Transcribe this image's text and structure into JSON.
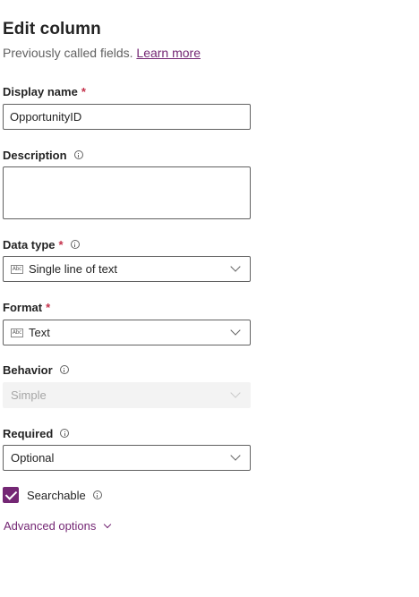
{
  "header": {
    "title": "Edit column",
    "subtitle": "Previously called fields.",
    "learn_more": "Learn more"
  },
  "fields": {
    "display_name": {
      "label": "Display name",
      "required_mark": "*",
      "value": "OpportunityID"
    },
    "description": {
      "label": "Description",
      "value": ""
    },
    "data_type": {
      "label": "Data type",
      "required_mark": "*",
      "value": "Single line of text",
      "icon": "abc-text-icon"
    },
    "format": {
      "label": "Format",
      "required_mark": "*",
      "value": "Text",
      "icon": "abc-text-icon"
    },
    "behavior": {
      "label": "Behavior",
      "value": "Simple",
      "disabled": true
    },
    "required": {
      "label": "Required",
      "value": "Optional"
    }
  },
  "searchable": {
    "label": "Searchable",
    "checked": true
  },
  "advanced": {
    "label": "Advanced options"
  },
  "colors": {
    "accent": "#742774",
    "required": "#c4314b"
  }
}
